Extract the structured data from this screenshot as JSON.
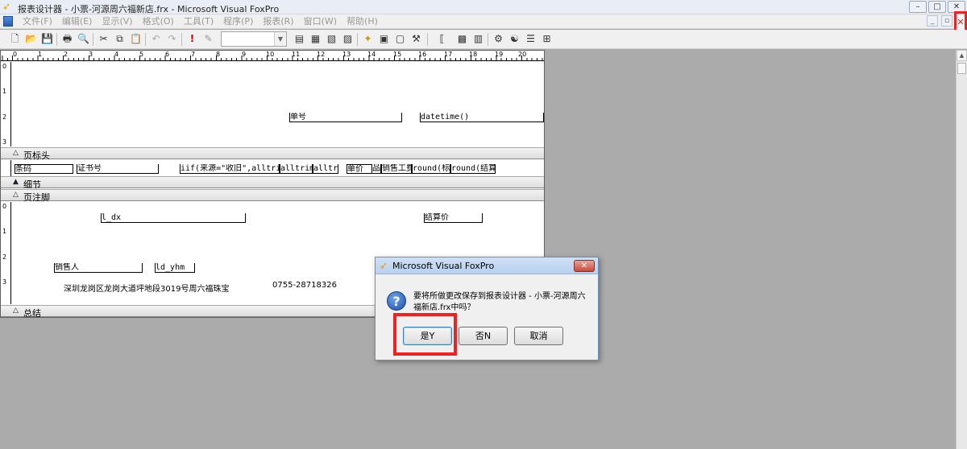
{
  "titlebar": {
    "title": "报表设计器 - 小票-河源周六福新店.frx - Microsoft Visual FoxPro",
    "buttons": [
      "–",
      "□",
      "✕"
    ]
  },
  "menubar": {
    "items": [
      "文件(F)",
      "编辑(E)",
      "显示(V)",
      "格式(O)",
      "工具(T)",
      "程序(P)",
      "报表(R)",
      "窗口(W)",
      "帮助(H)"
    ],
    "mdi_buttons": [
      "_",
      "▫"
    ],
    "close_glyph": "✕"
  },
  "toolbar": {
    "combo_value": "",
    "buttons": [
      "new",
      "open",
      "save",
      "print",
      "print-preview",
      "cut",
      "copy",
      "paste",
      "undo",
      "redo",
      "run",
      "modify",
      "data-env",
      "report-controls",
      "layout",
      "preview",
      "form-wizard",
      "builder",
      "expression",
      "command-window",
      "class-browser",
      "object-browser",
      "options",
      "code-refs",
      "properties",
      "toolbox"
    ]
  },
  "report": {
    "ruler_numbers": [
      "0",
      "1",
      "2",
      "3",
      "4",
      "5",
      "6",
      "7",
      "8",
      "9",
      "10",
      "11",
      "12",
      "13",
      "14",
      "15",
      "16",
      "17",
      "18",
      "19",
      "20"
    ],
    "vruler_numbers": [
      "0",
      "1",
      "2",
      "3"
    ],
    "bands": {
      "page_header": "页标头",
      "detail": "细节",
      "page_footer": "页注脚",
      "summary": "总结"
    },
    "header_fields": {
      "danhao": "单号",
      "datetime": "datetime()"
    },
    "detail_fields": [
      "条码",
      "证书号",
      "iif(来源=\"收旧\",alltri",
      "alltrim",
      "alltri",
      "单价",
      "品",
      "销售工费",
      "round(标",
      "round(结算价"
    ],
    "footer_fields": {
      "l_dx": "l_dx",
      "jiesuan": "结算价",
      "xiaoshouren": "销售人",
      "ld_yhm": "ld_yhm",
      "address": "深圳龙岗区龙岗大道坪地段3019号周六福珠宝",
      "phone": "0755-28718326"
    }
  },
  "dialog": {
    "title": "Microsoft Visual FoxPro",
    "message": "要将所做更改保存到报表设计器 - 小票-河源周六福新店.frx中吗？",
    "question_glyph": "?",
    "close_glyph": "✕",
    "yes_label": "是Y",
    "no_label": "否N",
    "cancel_label": "取消"
  }
}
